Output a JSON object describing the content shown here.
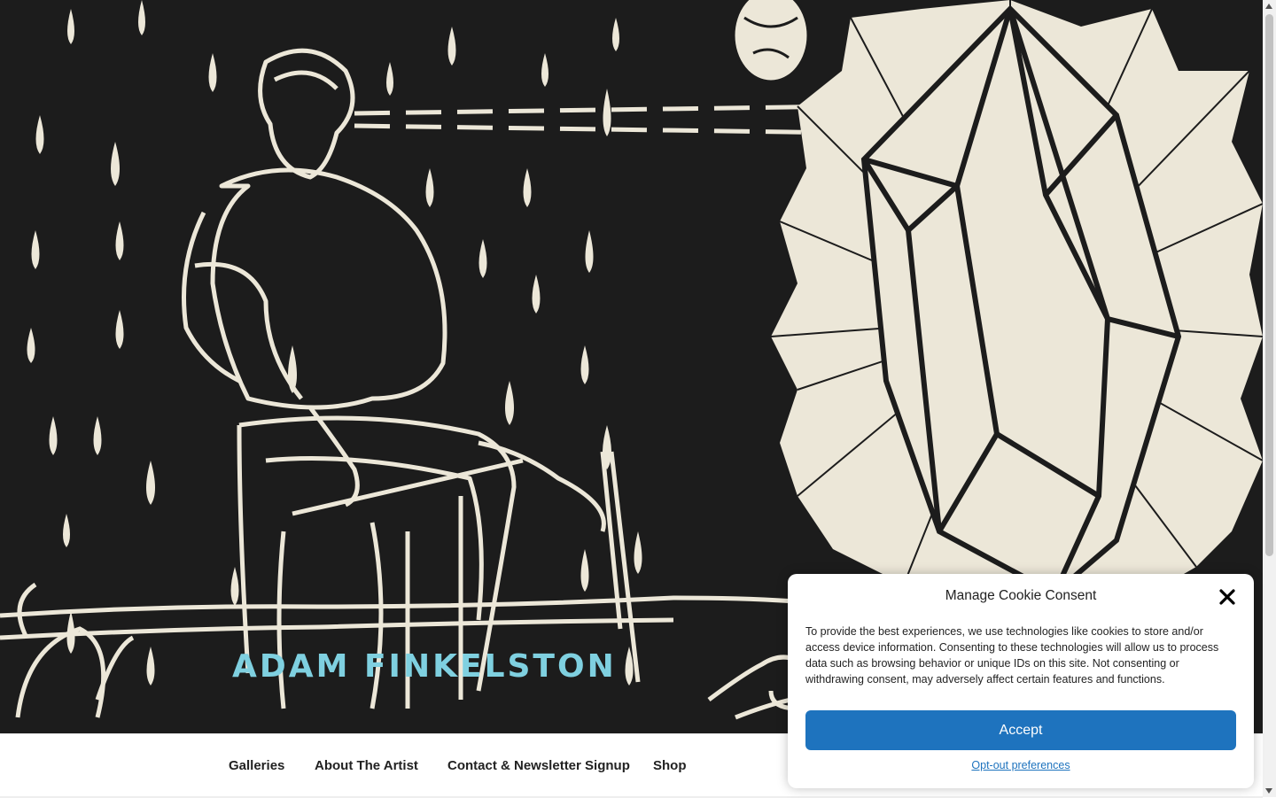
{
  "site": {
    "title": "ADAM FINKELSTON",
    "title_color": "#7fd0e0"
  },
  "hero": {
    "image_description_icon": "linocut-artwork-image",
    "background": "#1c1c1c",
    "ink": "#ece7d8"
  },
  "nav": {
    "items": [
      {
        "label": "Galleries"
      },
      {
        "label": "About The Artist"
      },
      {
        "label": "Contact & Newsletter Signup"
      },
      {
        "label": "Shop"
      }
    ]
  },
  "cookie": {
    "title": "Manage Cookie Consent",
    "body": "To provide the best experiences, we use technologies like cookies to store and/or access device information. Consenting to these technologies will allow us to process data such as browsing behavior or unique IDs on this site. Not consenting or withdrawing consent, may adversely affect certain features and functions.",
    "accept_label": "Accept",
    "optout_label": "Opt-out preferences",
    "accent": "#1e73be"
  }
}
